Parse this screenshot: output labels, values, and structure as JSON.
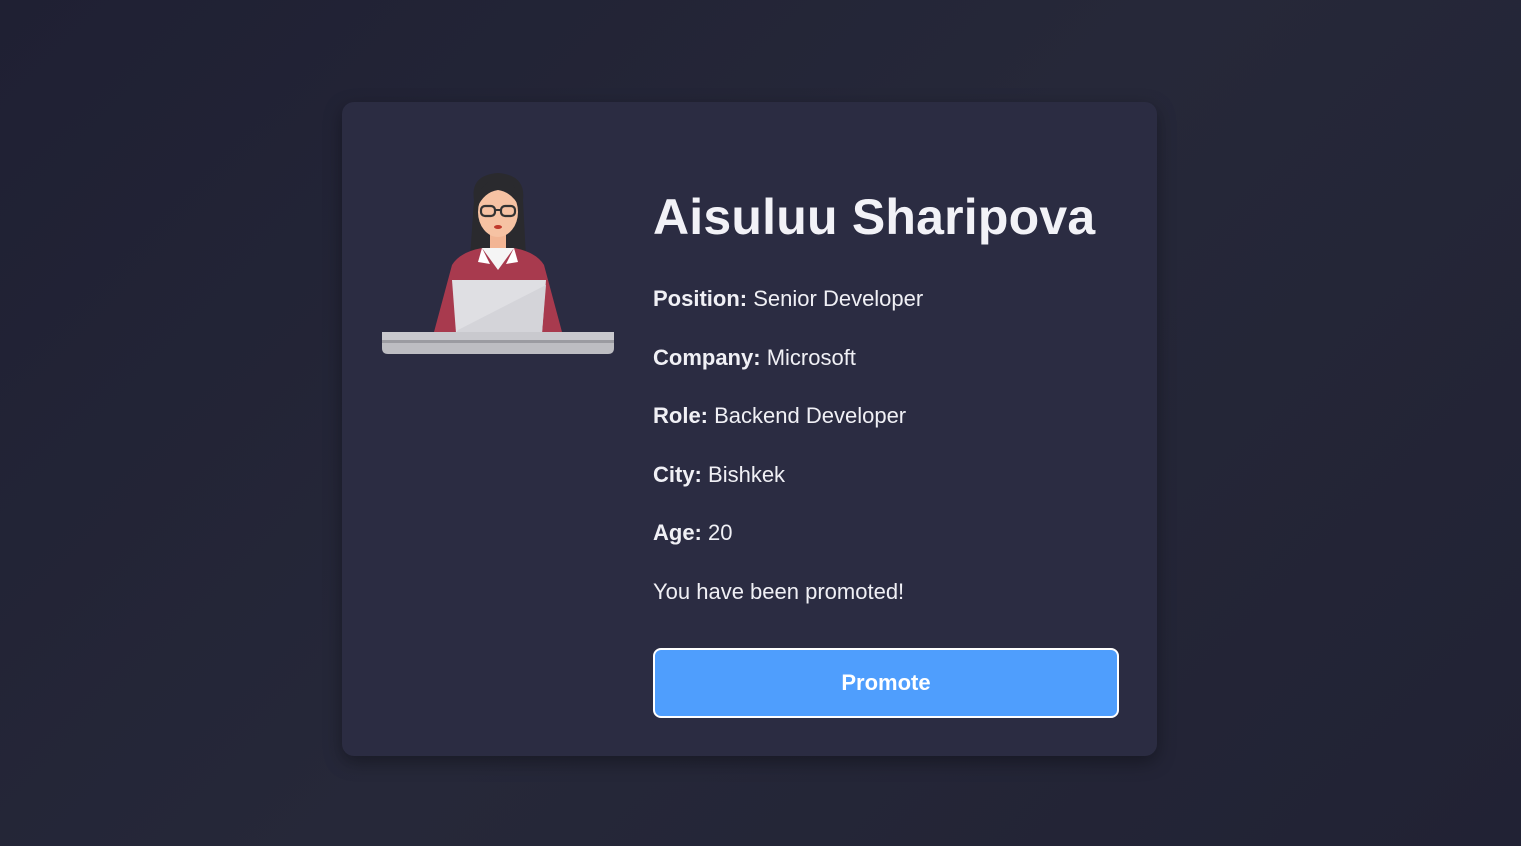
{
  "profile": {
    "name": "Aisuluu Sharipova",
    "avatar_icon": "woman-at-laptop-icon",
    "fields": [
      {
        "label": "Position:",
        "value": "Senior Developer"
      },
      {
        "label": "Company:",
        "value": "Microsoft"
      },
      {
        "label": "Role:",
        "value": "Backend Developer"
      },
      {
        "label": "City:",
        "value": "Bishkek"
      },
      {
        "label": "Age:",
        "value": "20"
      }
    ],
    "status_message": "You have been promoted!",
    "promote_label": "Promote"
  },
  "colors": {
    "background": "#23243a",
    "card": "#2b2c42",
    "button": "#4f9efd",
    "text": "#f0f0f5"
  }
}
